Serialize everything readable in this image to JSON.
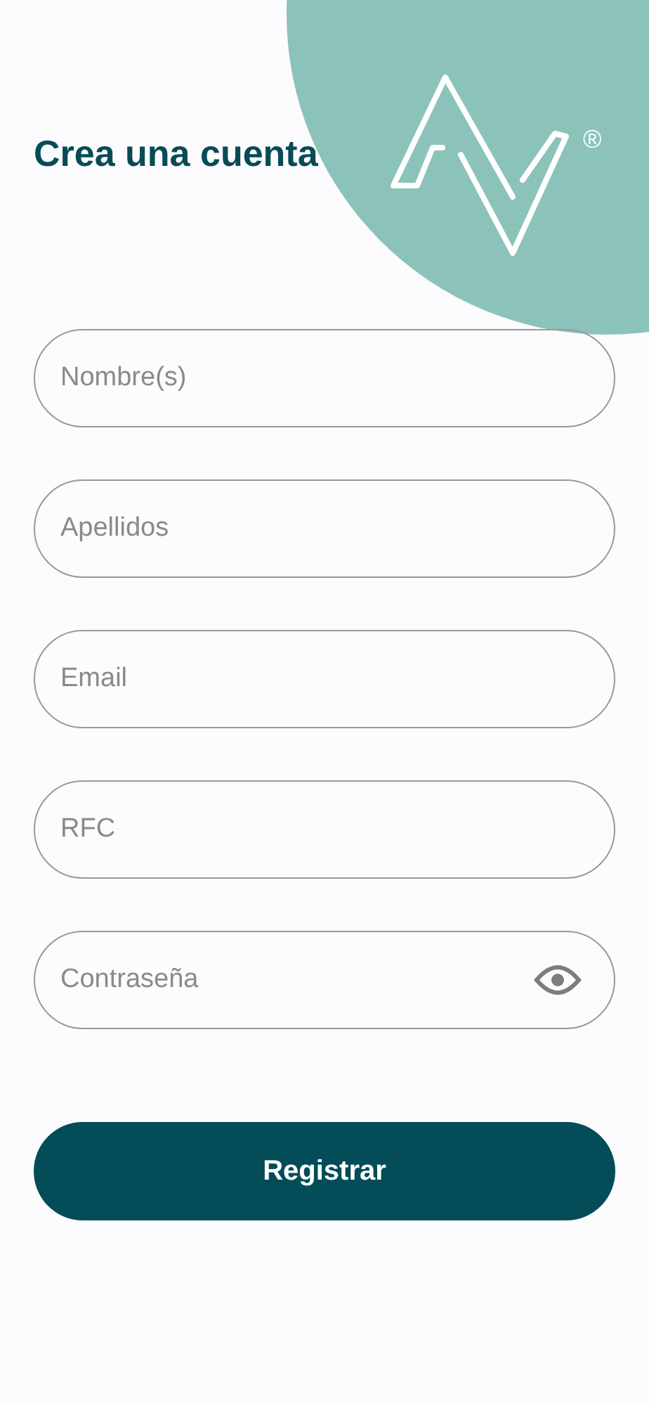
{
  "title": "Crea una cuenta",
  "logo": {
    "registered_mark": "®"
  },
  "fields": [
    {
      "placeholder": "Nombre(s)",
      "kind": "text"
    },
    {
      "placeholder": "Apellidos",
      "kind": "text"
    },
    {
      "placeholder": "Email",
      "kind": "text"
    },
    {
      "placeholder": "RFC",
      "kind": "text"
    },
    {
      "placeholder": "Contraseña",
      "kind": "password"
    }
  ],
  "submit_button": "Registrar"
}
